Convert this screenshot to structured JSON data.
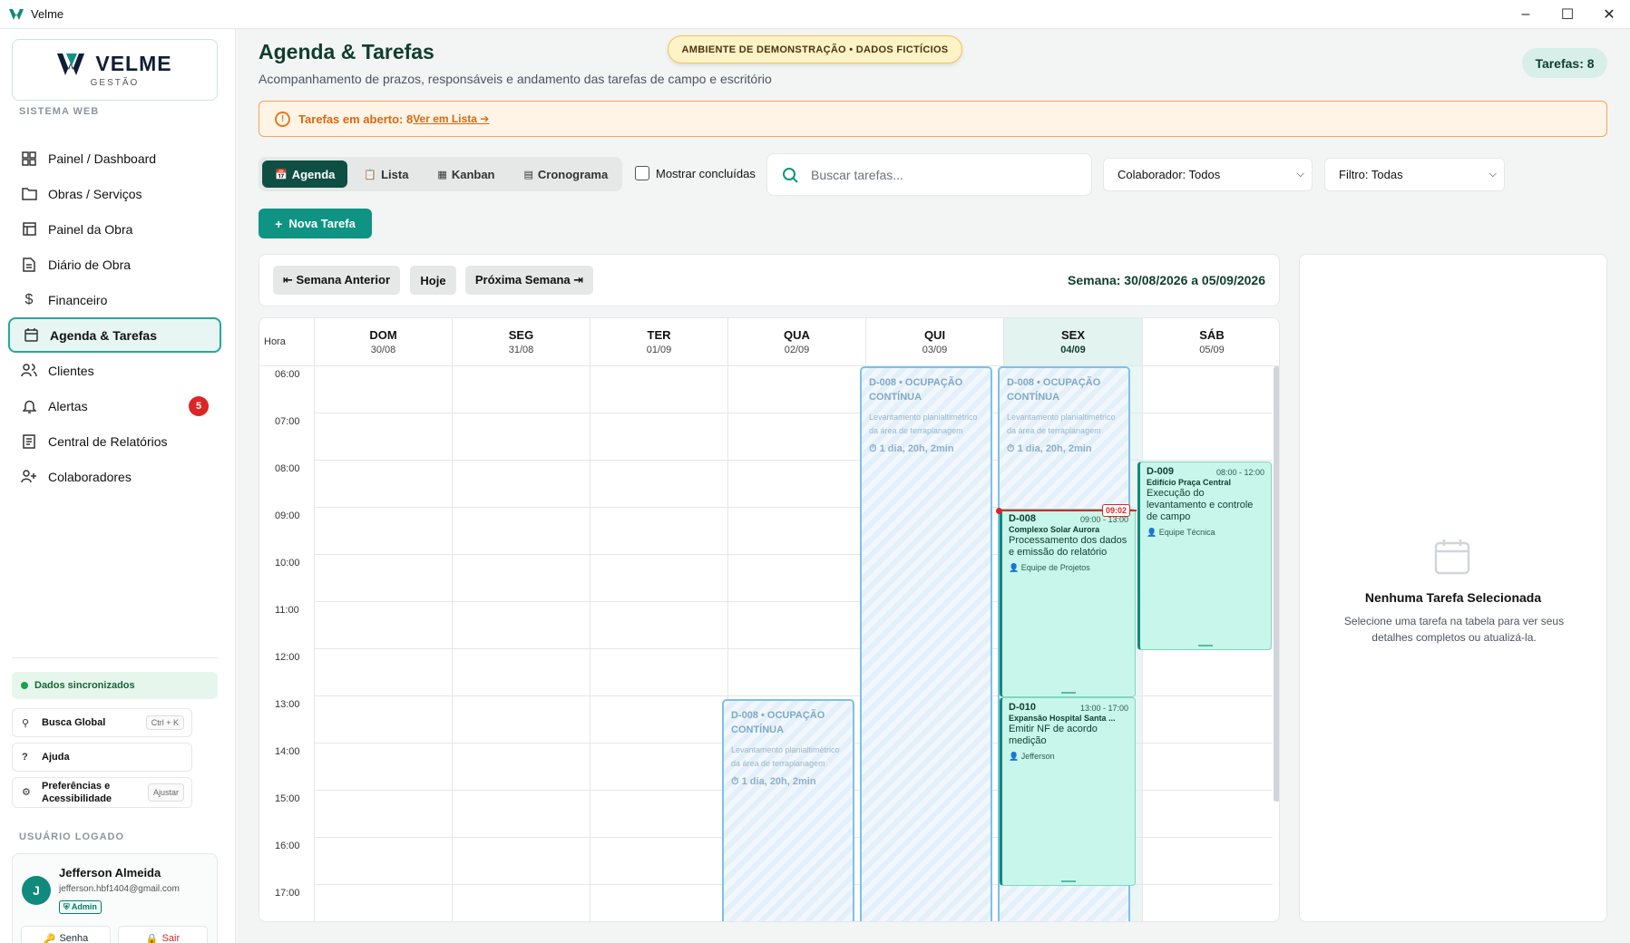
{
  "window": {
    "title": "Velme"
  },
  "sidebar": {
    "brand": {
      "name": "VELME",
      "subtitle": "GESTÃO"
    },
    "section_label": "SISTEMA WEB",
    "items": [
      {
        "label": "Painel / Dashboard",
        "icon": "grid-icon"
      },
      {
        "label": "Obras / Serviços",
        "icon": "folder-icon"
      },
      {
        "label": "Painel da Obra",
        "icon": "layout-icon"
      },
      {
        "label": "Diário de Obra",
        "icon": "file-icon"
      },
      {
        "label": "Financeiro",
        "icon": "dollar-icon"
      },
      {
        "label": "Agenda & Tarefas",
        "icon": "calendar-icon",
        "active": true
      },
      {
        "label": "Clientes",
        "icon": "users-icon"
      },
      {
        "label": "Alertas",
        "icon": "bell-icon",
        "badge": "5"
      },
      {
        "label": "Central de Relatórios",
        "icon": "report-icon"
      },
      {
        "label": "Colaboradores",
        "icon": "user-plus-icon"
      }
    ],
    "sync_status": "Dados sincronizados",
    "global_search": {
      "label": "Busca Global",
      "shortcut": "Ctrl + K"
    },
    "help_label": "Ajuda",
    "preferences": {
      "label": "Preferências e Acessibilidade",
      "action": "Ajustar"
    },
    "user_section_label": "USUÁRIO LOGADO",
    "user": {
      "initial": "J",
      "name": "Jefferson Almeida",
      "email": "jefferson.hbf1404@gmail.com",
      "role": "Admin",
      "password_label": "Senha",
      "logout_label": "Sair"
    }
  },
  "header": {
    "title": "Agenda & Tarefas",
    "subtitle": "Acompanhamento de prazos, responsáveis e andamento das tarefas de campo e escritório",
    "demo_badge": "AMBIENTE DE DEMONSTRAÇÃO • DADOS FICTÍCIOS",
    "task_count": "Tarefas: 8"
  },
  "alert": {
    "text": "Tarefas em aberto: 8",
    "link": "Ver em Lista ➔"
  },
  "toolbar": {
    "tabs": [
      "Agenda",
      "Lista",
      "Kanban",
      "Cronograma"
    ],
    "active_tab": "Agenda",
    "show_completed_label": "Mostrar concluídas",
    "search_placeholder": "Buscar tarefas...",
    "collaborator_select": "Colaborador: Todos",
    "filter_select": "Filtro: Todas",
    "new_task_label": "Nova Tarefa"
  },
  "calendar": {
    "prev_week": "⇤ Semana Anterior",
    "today": "Hoje",
    "next_week": "Próxima Semana ⇥",
    "week_label": "Semana: 30/08/2026 a 05/09/2026",
    "hour_header": "Hora",
    "days": [
      {
        "name": "DOM",
        "date": "30/08"
      },
      {
        "name": "SEG",
        "date": "31/08"
      },
      {
        "name": "TER",
        "date": "01/09"
      },
      {
        "name": "QUA",
        "date": "02/09"
      },
      {
        "name": "QUI",
        "date": "03/09"
      },
      {
        "name": "SEX",
        "date": "04/09",
        "today": true
      },
      {
        "name": "SÁB",
        "date": "05/09"
      }
    ],
    "hours": [
      "06:00",
      "07:00",
      "08:00",
      "09:00",
      "10:00",
      "11:00",
      "12:00",
      "13:00",
      "14:00",
      "15:00",
      "16:00",
      "17:00"
    ],
    "now_label": "09:02",
    "ghost_task": {
      "title": "D-008 • OCUPAÇÃO CONTÍNUA",
      "description": "Levantamento planialtimétrico da área de terraplanagem",
      "duration": "⏱ 1 dia, 20h, 2min"
    },
    "tasks": [
      {
        "code": "D-009",
        "time": "08:00 - 12:00",
        "client": "Edifício Praça Central",
        "description": "Execução do levantamento e controle de campo",
        "team": "Equipe Técnica"
      },
      {
        "code": "D-008",
        "time": "09:00 - 13:00",
        "client": "Complexo Solar Aurora",
        "description": "Processamento dos dados e emissão do relatório",
        "team": "Equipe de Projetos"
      },
      {
        "code": "D-010",
        "time": "13:00 - 17:00",
        "client": "Expansão Hospital Santa ...",
        "description": "Emitir NF de acordo medição",
        "team": "Jefferson"
      }
    ]
  },
  "detail": {
    "title": "Nenhuma Tarefa Selecionada",
    "text": "Selecione uma tarefa na tabela para ver seus detalhes completos ou atualizá-la."
  },
  "colors": {
    "primary": "#0f4f43",
    "accent": "#0f9483",
    "task_bg": "#c8f6ea",
    "alert": "#d9680f",
    "danger": "#dc2626"
  }
}
